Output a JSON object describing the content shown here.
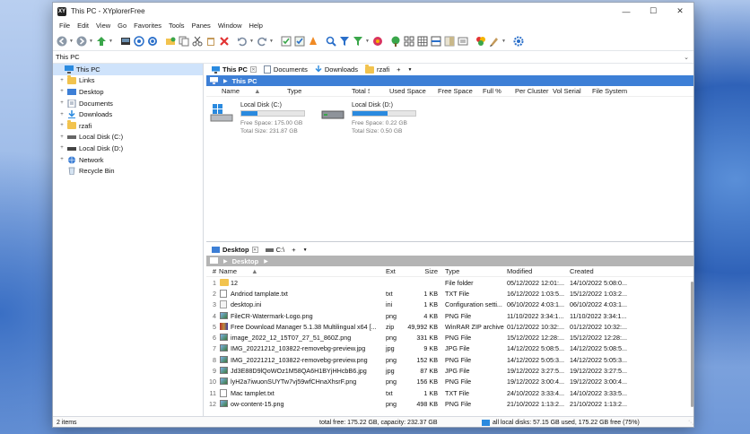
{
  "window": {
    "title": "This PC - XYplorerFree",
    "app_icon_text": "XY"
  },
  "menu": [
    "File",
    "Edit",
    "View",
    "Go",
    "Favorites",
    "Tools",
    "Panes",
    "Window",
    "Help"
  ],
  "toolbar_icons": [
    "back-icon",
    "forward-icon",
    "up-icon",
    "console-icon",
    "target-icon",
    "find-icon",
    "new-folder-icon",
    "copy-icon",
    "cut-icon",
    "paste-icon",
    "delete-icon",
    "undo-icon",
    "redo-icon",
    "select-icon",
    "check-icon",
    "highlight-icon",
    "search-icon",
    "filter-icon",
    "visual-filter-icon",
    "hide-icon",
    "tree-icon",
    "thumbnails-icon",
    "grid-icon",
    "list-icon",
    "preview-icon",
    "info-icon",
    "color-icon",
    "paint-icon",
    "settings-icon"
  ],
  "address": {
    "path": "This PC"
  },
  "tree": {
    "items": [
      {
        "label": "This PC",
        "level": 0,
        "expander": "",
        "icon": "pc-icon",
        "selected": true
      },
      {
        "label": "Links",
        "level": 1,
        "expander": "+",
        "icon": "folder-icon"
      },
      {
        "label": "Desktop",
        "level": 1,
        "expander": "+",
        "icon": "desktop-icon"
      },
      {
        "label": "Documents",
        "level": 1,
        "expander": "+",
        "icon": "documents-icon"
      },
      {
        "label": "Downloads",
        "level": 1,
        "expander": "+",
        "icon": "downloads-icon"
      },
      {
        "label": "rzafi",
        "level": 1,
        "expander": "+",
        "icon": "folder-icon"
      },
      {
        "label": "Local Disk (C:)",
        "level": 1,
        "expander": "+",
        "icon": "drive-icon"
      },
      {
        "label": "Local Disk (D:)",
        "level": 1,
        "expander": "+",
        "icon": "drive-icon"
      },
      {
        "label": "Network",
        "level": 1,
        "expander": "+",
        "icon": "network-icon"
      },
      {
        "label": "Recycle Bin",
        "level": 1,
        "expander": "",
        "icon": "recycle-bin-icon"
      }
    ]
  },
  "top_pane": {
    "tabs": [
      {
        "label": "This PC",
        "active": true,
        "icon": "pc-icon",
        "closable": true
      },
      {
        "label": "Documents",
        "icon": "documents-icon"
      },
      {
        "label": "Downloads",
        "icon": "downloads-icon"
      },
      {
        "label": "rzafi",
        "icon": "folder-icon"
      }
    ],
    "add_tab": "+",
    "breadcrumb": "This PC",
    "columns": [
      "Name",
      "Type",
      "Total Size",
      "Used Space",
      "Free Space",
      "Full %",
      "Per Cluster",
      "Vol Serial",
      "File System"
    ],
    "drives": [
      {
        "name": "Local Disk (C:)",
        "used_fraction": 0.25,
        "free": "Free Space: 175.00 GB",
        "total": "Total Size: 231.87 GB"
      },
      {
        "name": "Local Disk (D:)",
        "used_fraction": 0.56,
        "free": "Free Space: 0.22 GB",
        "total": "Total Size: 0.50 GB"
      }
    ]
  },
  "bottom_pane": {
    "tabs": [
      {
        "label": "Desktop",
        "active": true,
        "icon": "desktop-icon",
        "closable": true
      },
      {
        "label": "C:\\",
        "icon": "drive-icon"
      }
    ],
    "add_tab": "+",
    "breadcrumb": "Desktop",
    "columns": {
      "num": "#",
      "name": "Name",
      "ext": "Ext",
      "size": "Size",
      "type": "Type",
      "modified": "Modified",
      "created": "Created"
    },
    "files": [
      {
        "num": "1",
        "name": "12",
        "ext": "",
        "size": "",
        "type": "File folder",
        "modified": "05/12/2022 12:01:...",
        "created": "14/10/2022 5:08:0...",
        "icon": "folder-icon"
      },
      {
        "num": "2",
        "name": "Andriod tamplate.txt",
        "ext": "txt",
        "size": "1 KB",
        "type": "TXT File",
        "modified": "16/12/2022 1:03:5...",
        "created": "15/12/2022 1:03:2...",
        "icon": "text-file-icon"
      },
      {
        "num": "3",
        "name": "desktop.ini",
        "ext": "ini",
        "size": "1 KB",
        "type": "Configuration setti...",
        "modified": "06/10/2022 4:03:1...",
        "created": "06/10/2022 4:03:1...",
        "icon": "ini-file-icon"
      },
      {
        "num": "4",
        "name": "FileCR-Watermark-Logo.png",
        "ext": "png",
        "size": "4 KB",
        "type": "PNG File",
        "modified": "11/10/2022 3:34:1...",
        "created": "11/10/2022 3:34:1...",
        "icon": "image-file-icon"
      },
      {
        "num": "5",
        "name": "Free Download Manager 5.1.38 Multilingual x64 [...",
        "ext": "zip",
        "size": "49,992 KB",
        "type": "WinRAR ZIP archive",
        "modified": "01/12/2022 10:32:...",
        "created": "01/12/2022 10:32:...",
        "icon": "zip-file-icon"
      },
      {
        "num": "6",
        "name": "image_2022_12_15T07_27_51_860Z.png",
        "ext": "png",
        "size": "331 KB",
        "type": "PNG File",
        "modified": "15/12/2022 12:28:...",
        "created": "15/12/2022 12:28:...",
        "icon": "image-file-icon"
      },
      {
        "num": "7",
        "name": "IMG_20221212_103822-removebg-preview.jpg",
        "ext": "jpg",
        "size": "9 KB",
        "type": "JPG File",
        "modified": "14/12/2022 5:08:5...",
        "created": "14/12/2022 5:08:5...",
        "icon": "image-file-icon"
      },
      {
        "num": "8",
        "name": "IMG_20221212_103822-removebg-preview.png",
        "ext": "png",
        "size": "152 KB",
        "type": "PNG File",
        "modified": "14/12/2022 5:05:3...",
        "created": "14/12/2022 5:05:3...",
        "icon": "image-file-icon"
      },
      {
        "num": "9",
        "name": "Jd3E88D9lQoWOz1M58QA6H1BYjHHcbB6.jpg",
        "ext": "jpg",
        "size": "87 KB",
        "type": "JPG File",
        "modified": "19/12/2022 3:27:5...",
        "created": "19/12/2022 3:27:5...",
        "icon": "image-file-icon"
      },
      {
        "num": "10",
        "name": "lyH2a7iwuonSUYTw7vj59wfCHnaXhsrF.png",
        "ext": "png",
        "size": "156 KB",
        "type": "PNG File",
        "modified": "19/12/2022 3:00:4...",
        "created": "19/12/2022 3:00:4...",
        "icon": "image-file-icon"
      },
      {
        "num": "11",
        "name": "Mac tamplet.txt",
        "ext": "txt",
        "size": "1 KB",
        "type": "TXT File",
        "modified": "24/10/2022 3:33:4...",
        "created": "14/10/2022 3:33:5...",
        "icon": "text-file-icon"
      },
      {
        "num": "12",
        "name": "ow-content-15.png",
        "ext": "png",
        "size": "498 KB",
        "type": "PNG File",
        "modified": "21/10/2022 1:13:2...",
        "created": "21/10/2022 1:13:2...",
        "icon": "image-file-icon"
      }
    ]
  },
  "status": {
    "items": "2 items",
    "total": "total free: 175.22 GB, capacity: 232.37 GB",
    "disks": "all local disks: 57.15 GB used, 175.22 GB free (75%)"
  }
}
